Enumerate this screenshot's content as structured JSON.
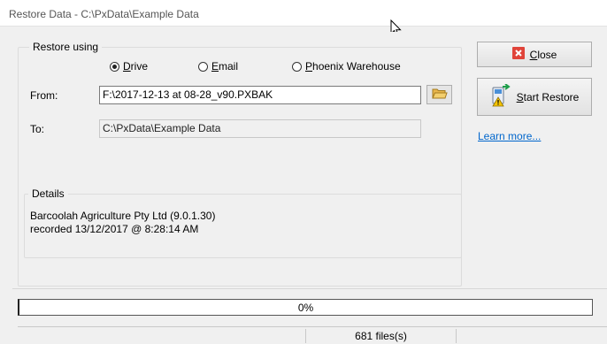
{
  "window": {
    "title": "Restore Data - C:\\PxData\\Example Data"
  },
  "restore_using": {
    "legend": "Restore using",
    "options": [
      {
        "label": "Drive",
        "mnemonic": "D",
        "rest": "rive",
        "selected": true
      },
      {
        "label": "Email",
        "mnemonic": "E",
        "rest": "mail",
        "selected": false
      },
      {
        "label": "Phoenix Warehouse",
        "mnemonic": "P",
        "rest": "hoenix Warehouse",
        "selected": false
      }
    ]
  },
  "from": {
    "label": "From:",
    "value": "F:\\2017-12-13 at 08-28_v90.PXBAK"
  },
  "to": {
    "label": "To:",
    "value": "C:\\PxData\\Example Data"
  },
  "details": {
    "legend": "Details",
    "line1": "Barcoolah Agriculture Pty Ltd  (9.0.1.30)",
    "line2": "recorded 13/12/2017 @ 8:28:14 AM"
  },
  "buttons": {
    "close": {
      "mnemonic": "C",
      "rest": "lose"
    },
    "start": {
      "mnemonic": "S",
      "rest": "tart Restore"
    }
  },
  "learn_more": "Learn more...",
  "progress": {
    "percent": 0,
    "text": "0%"
  },
  "status": {
    "files": "681 files(s)"
  },
  "icons": {
    "browse": "folder-icon",
    "close": "close-icon",
    "start": "restore-icon",
    "cursor": "mouse-cursor-icon"
  },
  "colors": {
    "close_red": "#e0443a",
    "link": "#0066cc",
    "progress_fill": "#06b025"
  }
}
